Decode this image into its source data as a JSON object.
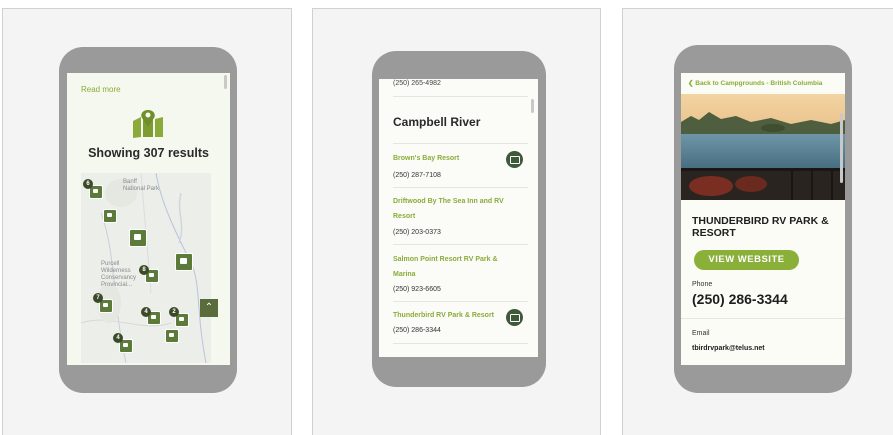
{
  "panel1": {
    "read_more": "Read more",
    "results": "Showing 307 results",
    "map_labels": {
      "banff": "Banff\nNational Park",
      "purcell": "Purcell\nWilderness\nConservancy\nProvincial..."
    },
    "badges": [
      "6",
      "8",
      "7",
      "4",
      "2",
      "4"
    ],
    "back_to_top": "⌃"
  },
  "panel2": {
    "top_phone": "(250) 265-4982",
    "city": "Campbell River",
    "listings": [
      {
        "name": "Brown's Bay Resort",
        "phone": "(250) 287-7108"
      },
      {
        "name": "Driftwood By The Sea Inn and RV Resort",
        "phone": "(250) 203-0373"
      },
      {
        "name": "Salmon Point Resort RV Park & Marina",
        "phone": "(250) 923-6605"
      },
      {
        "name": "Thunderbird RV Park & Resort",
        "phone": "(250) 286-3344"
      }
    ]
  },
  "panel3": {
    "back_link": "❮ Back to Campgrounds - British Columbia",
    "park_name": "THUNDERBIRD RV PARK & RESORT",
    "website_button": "VIEW WEBSITE",
    "phone_label": "Phone",
    "phone_value": "(250) 286-3344",
    "email_label": "Email",
    "email_value": "tbirdrvpark@telus.net"
  },
  "colors": {
    "accent": "#8aab3a",
    "pin": "#5c7a3a",
    "phone_frame": "#9a9a9a",
    "dark_green": "#3e5a3a"
  },
  "icons": [
    "map-pin-icon",
    "rv-pin-icon",
    "photo-icon",
    "chevron-up-icon",
    "chevron-left-icon"
  ]
}
